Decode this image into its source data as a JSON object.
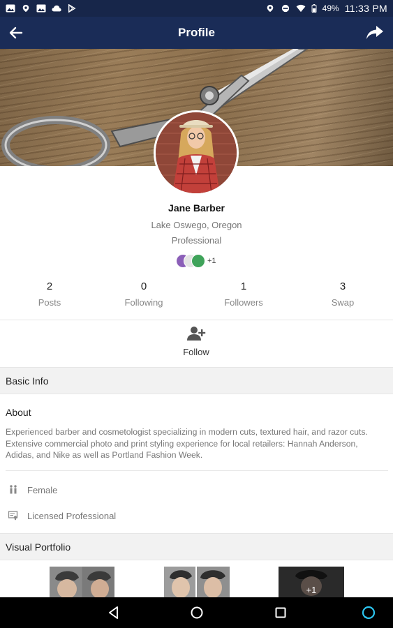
{
  "status_bar": {
    "battery": "49%",
    "time": "11:33 PM",
    "icons": [
      "gallery-icon",
      "location-pin-icon",
      "image-icon",
      "cloud-icon",
      "play-store-icon",
      "location-icon",
      "do-not-disturb-icon",
      "wifi-icon",
      "battery-icon"
    ]
  },
  "app_bar": {
    "title": "Profile",
    "back_icon": "arrow-back-icon",
    "share_icon": "share-icon"
  },
  "profile": {
    "name": "Jane Barber",
    "location": "Lake Oswego, Oregon",
    "role": "Professional",
    "badges_more": "+1"
  },
  "stats": [
    {
      "value": "2",
      "label": "Posts"
    },
    {
      "value": "0",
      "label": "Following"
    },
    {
      "value": "1",
      "label": "Followers"
    },
    {
      "value": "3",
      "label": "Swap"
    }
  ],
  "follow": {
    "label": "Follow",
    "icon": "person-add-icon"
  },
  "basic_info": {
    "header": "Basic Info",
    "about_title": "About",
    "about_text": "Experienced barber and cosmetologist specializing in modern cuts, textured hair, and  razor cuts. Extensive commercial photo and print styling experience for local retailers: Hannah Anderson, Adidas, and Nike as well as Portland Fashion Week.",
    "gender": "Female",
    "license": "Licensed Professional"
  },
  "portfolio": {
    "header": "Visual Portfolio",
    "more": "+1"
  },
  "colors": {
    "app_bar": "#1a2c57",
    "status_bar": "#17264a",
    "section_bg": "#f2f2f2"
  }
}
